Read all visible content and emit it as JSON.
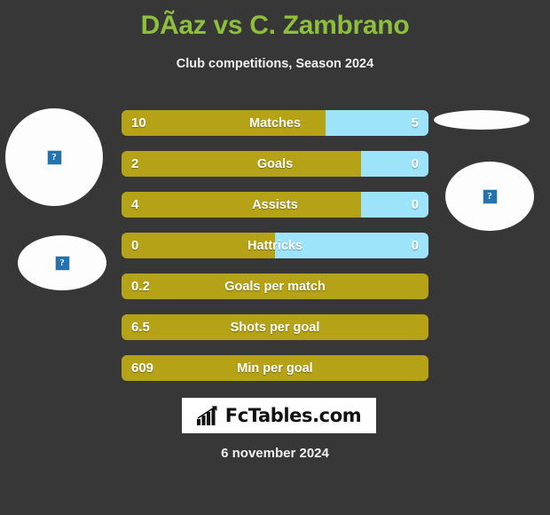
{
  "header": {
    "title": "DÃ­az vs C. Zambrano",
    "subtitle": "Club competitions, Season 2024",
    "title_color": "#8DBF3C"
  },
  "colors": {
    "background": "#373737",
    "home_bar": "#B5A216",
    "away_bar": "#9DE3FA",
    "text": "#FFFFFF",
    "accent_green": "#8DBF3C"
  },
  "avatars": [
    {
      "name": "home-player-photo-top",
      "placeholder": "broken-image-icon",
      "side": "left"
    },
    {
      "name": "home-player-photo-bottom",
      "placeholder": "broken-image-icon",
      "side": "left"
    },
    {
      "name": "away-player-photo-top",
      "placeholder": "",
      "side": "right"
    },
    {
      "name": "away-player-photo-bottom",
      "placeholder": "broken-image-icon",
      "side": "right"
    }
  ],
  "chart_data": {
    "type": "bar",
    "title": "DÃ­az vs C. Zambrano",
    "subtitle": "Club competitions, Season 2024",
    "orientation": "horizontal-diverging",
    "categories": [
      "Matches",
      "Goals",
      "Assists",
      "Hattricks",
      "Goals per match",
      "Shots per goal",
      "Min per goal"
    ],
    "series": [
      {
        "name": "DÃ­az",
        "values": [
          "10",
          "2",
          "4",
          "0",
          "0.2",
          "6.5",
          "609"
        ]
      },
      {
        "name": "C. Zambrano",
        "values": [
          "5",
          "0",
          "0",
          "0",
          "",
          "",
          ""
        ]
      }
    ],
    "rows": [
      {
        "label": "Matches",
        "home": "10",
        "away": "5",
        "home_pct": 66.5,
        "has_away": true
      },
      {
        "label": "Goals",
        "home": "2",
        "away": "0",
        "home_pct": 78.0,
        "has_away": true
      },
      {
        "label": "Assists",
        "home": "4",
        "away": "0",
        "home_pct": 78.0,
        "has_away": true
      },
      {
        "label": "Hattricks",
        "home": "0",
        "away": "0",
        "home_pct": 50.0,
        "has_away": true
      },
      {
        "label": "Goals per match",
        "home": "0.2",
        "away": "",
        "home_pct": 100,
        "has_away": false
      },
      {
        "label": "Shots per goal",
        "home": "6.5",
        "away": "",
        "home_pct": 100,
        "has_away": false
      },
      {
        "label": "Min per goal",
        "home": "609",
        "away": "",
        "home_pct": 100,
        "has_away": false
      }
    ],
    "legend": [
      "DÃ­az",
      "C. Zambrano"
    ],
    "grid": false
  },
  "footer": {
    "logo_text": "FcTables.com",
    "logo_icon": "bar-chart-arrow-icon",
    "date": "6 november 2024"
  }
}
